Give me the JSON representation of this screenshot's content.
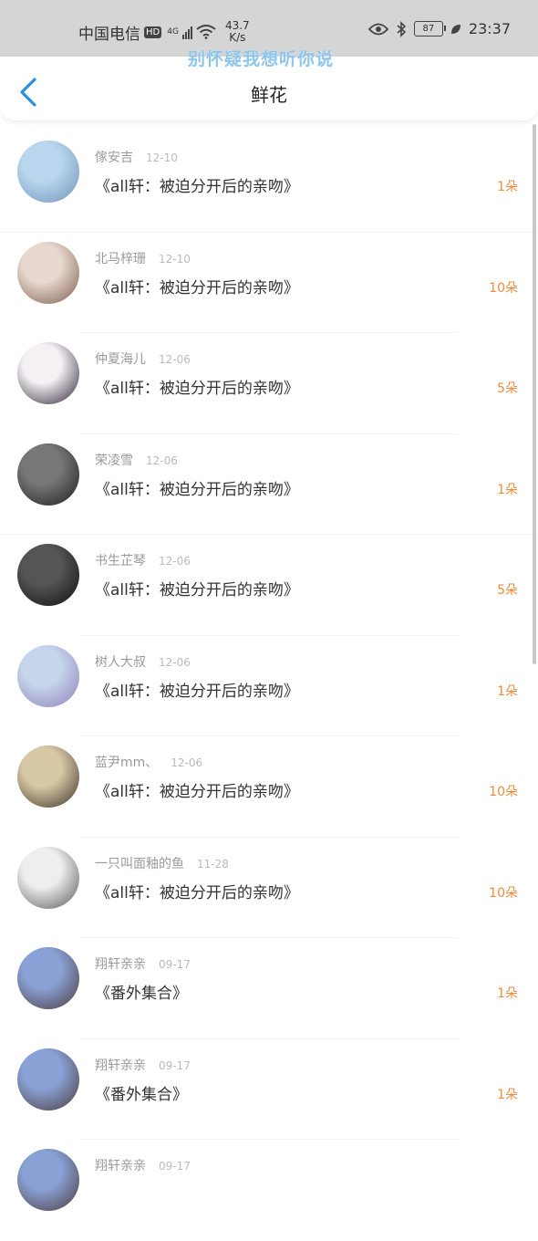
{
  "status_bar": {
    "carrier": "中国电信",
    "hd": "HD",
    "network": "4G",
    "speed_value": "43.7",
    "speed_unit": "K/s",
    "battery": "87",
    "time": "23:37"
  },
  "watermark": "别怀疑我想听你说",
  "header": {
    "title": "鲜花"
  },
  "items": [
    {
      "name": "傢安吉",
      "date": "12-10",
      "title": "《all轩：被迫分开后的亲吻》",
      "count": "1朵",
      "avatar": [
        "#b9d6ee",
        "#6f92b8"
      ]
    },
    {
      "name": "北马梓珊",
      "date": "12-10",
      "title": "《all轩：被迫分开后的亲吻》",
      "count": "10朵",
      "avatar": [
        "#e8d8cf",
        "#7a5a4a"
      ]
    },
    {
      "name": "仲夏海儿",
      "date": "12-06",
      "title": "《all轩：被迫分开后的亲吻》",
      "count": "5朵",
      "avatar": [
        "#f4f0f4",
        "#2b2233"
      ]
    },
    {
      "name": "荣凌雪",
      "date": "12-06",
      "title": "《all轩：被迫分开后的亲吻》",
      "count": "1朵",
      "avatar": [
        "#777777",
        "#1c1c1c"
      ]
    },
    {
      "name": "书生芷琴",
      "date": "12-06",
      "title": "《all轩：被迫分开后的亲吻》",
      "count": "5朵",
      "avatar": [
        "#555555",
        "#0e0e0e"
      ]
    },
    {
      "name": "树人大叔",
      "date": "12-06",
      "title": "《all轩：被迫分开后的亲吻》",
      "count": "1朵",
      "avatar": [
        "#c5d5ec",
        "#8f7fb8"
      ]
    },
    {
      "name": "蓝尹mm、",
      "date": "12-06",
      "title": "《all轩：被迫分开后的亲吻》",
      "count": "10朵",
      "avatar": [
        "#d8c9a6",
        "#3a3026"
      ]
    },
    {
      "name": "一只叫面釉的鱼",
      "date": "11-28",
      "title": "《all轩：被迫分开后的亲吻》",
      "count": "10朵",
      "avatar": [
        "#eeeeee",
        "#555555"
      ]
    },
    {
      "name": "翔轩亲亲",
      "date": "09-17",
      "title": "《番外集合》",
      "count": "1朵",
      "avatar": [
        "#8aa1d6",
        "#4a3a3a"
      ]
    },
    {
      "name": "翔轩亲亲",
      "date": "09-17",
      "title": "《番外集合》",
      "count": "1朵",
      "avatar": [
        "#8aa1d6",
        "#4a3a3a"
      ]
    },
    {
      "name": "翔轩亲亲",
      "date": "09-17",
      "title": "",
      "count": "",
      "avatar": [
        "#8aa1d6",
        "#4a3a3a"
      ]
    }
  ]
}
